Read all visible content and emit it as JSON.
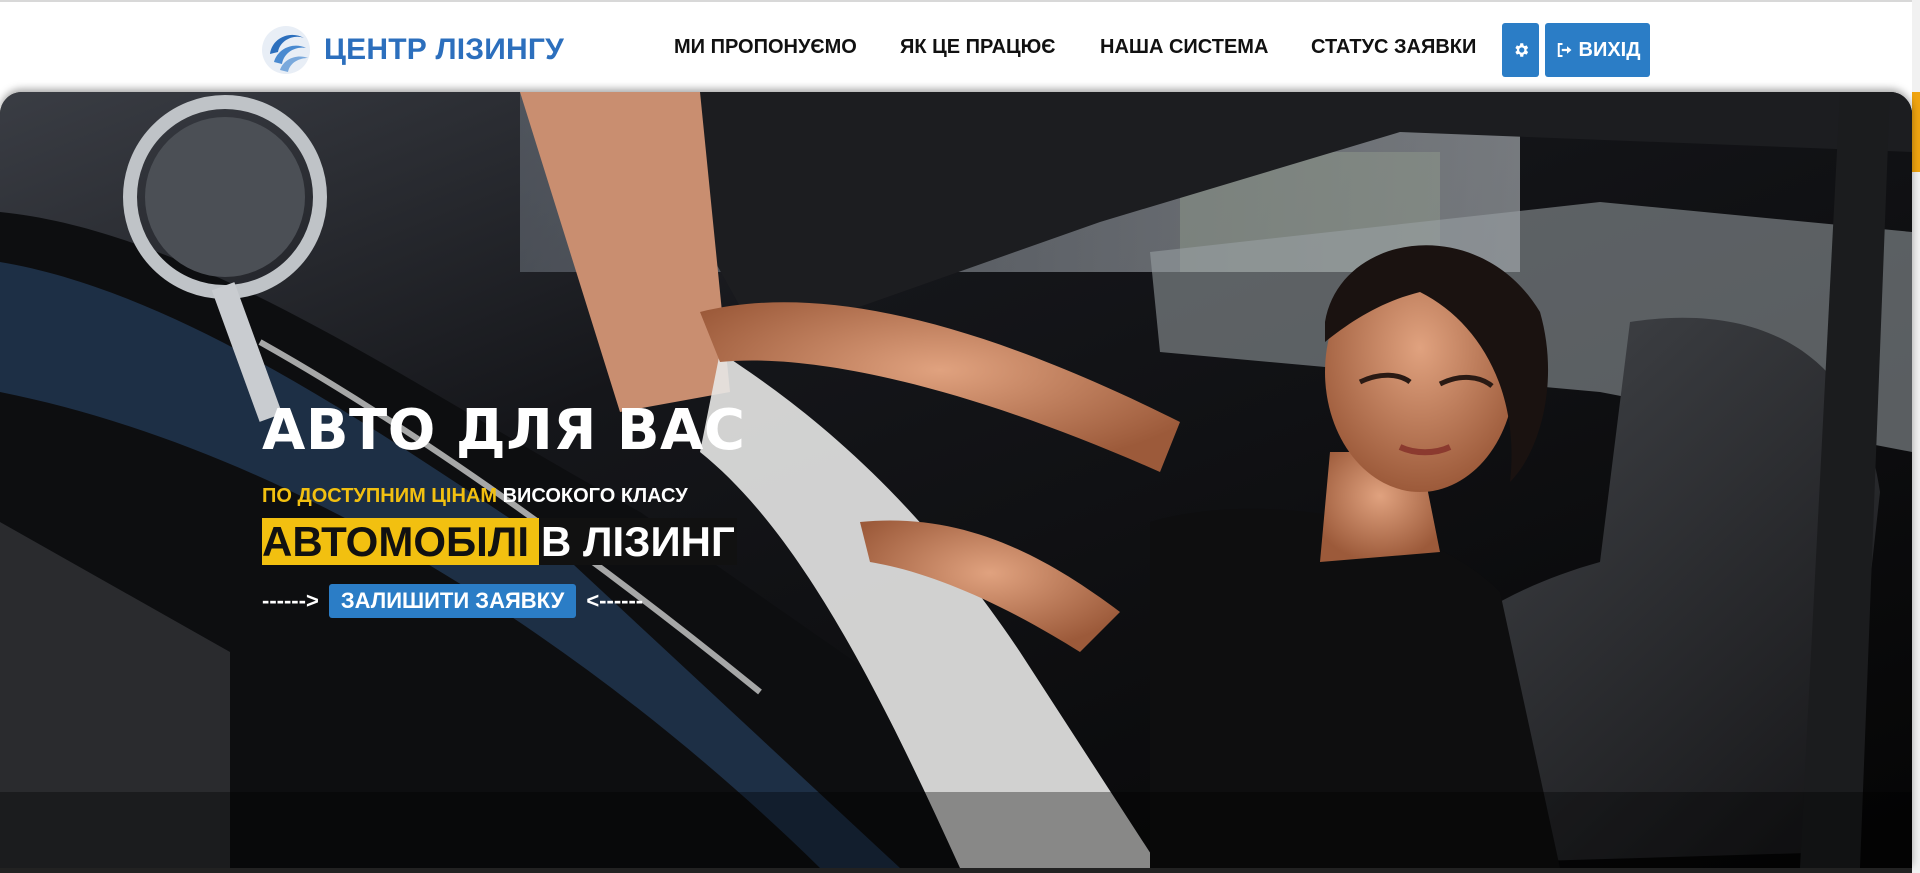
{
  "brand": {
    "name": "ЦЕНТР ЛІЗИНГУ",
    "logo_icon": "swirl-logo-icon",
    "color": "#2c6fbd"
  },
  "nav": {
    "items": [
      {
        "label": "МИ ПРОПОНУЄМО"
      },
      {
        "label": "ЯК ЦЕ ПРАЦЮЄ"
      },
      {
        "label": "НАША СИСТЕМА"
      },
      {
        "label": "СТАТУС ЗАЯВКИ"
      }
    ],
    "settings_icon": "gear-icon",
    "exit_icon": "sign-out-icon",
    "exit_label": "ВИХІД"
  },
  "hero": {
    "title": "АВТО ДЛЯ ВАС",
    "subtitle_highlight": "ПО ДОСТУПНИМ ЦІНАМ",
    "subtitle_rest": "ВИСОКОГО КЛАСУ",
    "big_highlight": "АВТОМОБІЛІ",
    "big_rest": "В ЛІЗИНГ",
    "arrow_left": "------>",
    "cta_label": "ЗАЛИШИТИ ЗАЯВКУ",
    "arrow_right": "<------"
  },
  "colors": {
    "accent_blue": "#2b7dc6",
    "accent_yellow": "#f2c010",
    "scroll_accent": "#f0a410"
  }
}
